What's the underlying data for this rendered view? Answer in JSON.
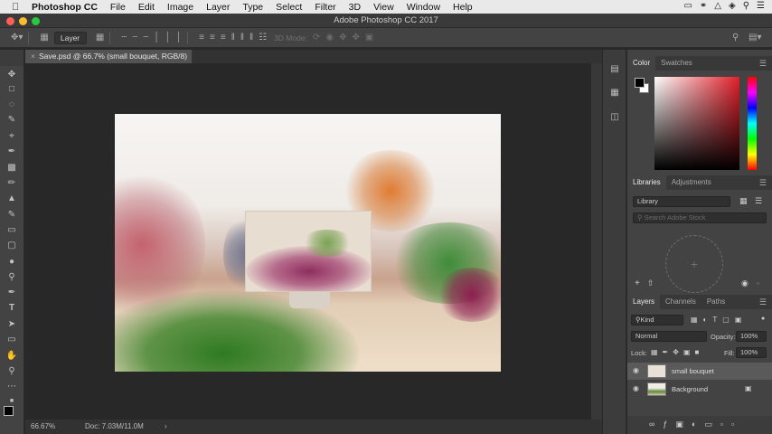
{
  "menubar": {
    "apple": "",
    "app": "Photoshop CC",
    "menus": [
      "File",
      "Edit",
      "Image",
      "Layer",
      "Type",
      "Select",
      "Filter",
      "3D",
      "View",
      "Window",
      "Help"
    ]
  },
  "window": {
    "title": "Adobe Photoshop CC 2017"
  },
  "options": {
    "auto_select": "Layer",
    "mode_label": "3D Mode:"
  },
  "document": {
    "tab": "Save.psd @ 66.7% (small bouquet, RGB/8) *",
    "zoom": "66.67%",
    "doc_size": "Doc: 7.03M/11.0M"
  },
  "color_panel": {
    "tabs": [
      "Color",
      "Swatches"
    ],
    "accent": "#e23d3d"
  },
  "libraries_panel": {
    "tabs": [
      "Libraries",
      "Adjustments"
    ],
    "library_select": "Library",
    "search_placeholder": "Search Adobe Stock"
  },
  "layers_panel": {
    "tabs": [
      "Layers",
      "Channels",
      "Paths"
    ],
    "filter": "Kind",
    "blend_mode": "Normal",
    "opacity_label": "Opacity:",
    "opacity": "100%",
    "lock_label": "Lock:",
    "fill_label": "Fill:",
    "fill": "100%",
    "layers": [
      {
        "name": "small bouquet",
        "selected": true
      },
      {
        "name": "Background",
        "selected": false
      }
    ]
  }
}
